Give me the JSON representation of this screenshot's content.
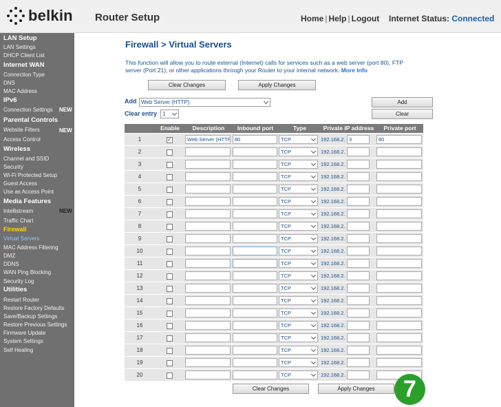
{
  "header": {
    "brand": "belkin",
    "app_title": "Router Setup",
    "nav": {
      "home": "Home",
      "help": "Help",
      "logout": "Logout"
    },
    "status_label": "Internet Status:",
    "status_value": "Connected"
  },
  "sidebar": {
    "sections": [
      {
        "title": "LAN Setup",
        "items": [
          "LAN Settings",
          "DHCP Client List"
        ]
      },
      {
        "title": "Internet WAN",
        "items": [
          "Connection Type",
          "DNS",
          "MAC Address"
        ]
      },
      {
        "title": "IPv6",
        "items": [
          "Connection Settings"
        ]
      },
      {
        "title": "Parental Controls",
        "items": [
          "Website Filters",
          "Access Control"
        ]
      },
      {
        "title": "Wireless",
        "items": [
          "Channel and SSID",
          "Security",
          "Wi-Fi Protected Setup",
          "Guest Access",
          "Use as Access Point"
        ]
      },
      {
        "title": "Media Features",
        "items": [
          "Intellistream",
          "Traffic Chart"
        ]
      },
      {
        "title": "Firewall",
        "items": [
          "Virtual Servers",
          "MAC Address Filtering",
          "DMZ",
          "DDNS",
          "WAN Ping Blocking",
          "Security Log"
        ]
      },
      {
        "title": "Utilities",
        "items": [
          "Restart Router",
          "Restore Factory Defaults",
          "Save/Backup Settings",
          "Restore Previous Settings",
          "Firmware Update",
          "System Settings",
          "Self Healing"
        ]
      }
    ],
    "new_badge": "NEW"
  },
  "main": {
    "title": "Firewall > Virtual Servers",
    "description": "This function will allow you to route external (Internet) calls for services such as a web server (port 80), FTP server (Port 21), or other applications through your Router to your internal network.",
    "more_info": "More Info",
    "clear_changes": "Clear Changes",
    "apply_changes": "Apply Changes",
    "add_label": "Add",
    "add_select": "Web Server (HTTP)",
    "add_button": "Add",
    "clear_entry_label": "Clear entry",
    "clear_entry_select": "1",
    "clear_button": "Clear"
  },
  "table": {
    "headers": [
      "Enable",
      "Description",
      "Inbound port",
      "Type",
      "Private IP address",
      "Private port"
    ],
    "ip_prefix": "192.168.2.",
    "rows": [
      {
        "num": "1",
        "enabled": true,
        "description": "Web Server (HTTP)",
        "inbound": "80",
        "type": "TCP",
        "ip_last": "3",
        "private_port": "80"
      },
      {
        "num": "2",
        "enabled": false,
        "description": "",
        "inbound": "",
        "type": "TCP",
        "ip_last": "",
        "private_port": ""
      },
      {
        "num": "3",
        "enabled": false,
        "description": "",
        "inbound": "",
        "type": "TCP",
        "ip_last": "",
        "private_port": ""
      },
      {
        "num": "4",
        "enabled": false,
        "description": "",
        "inbound": "",
        "type": "TCP",
        "ip_last": "",
        "private_port": ""
      },
      {
        "num": "5",
        "enabled": false,
        "description": "",
        "inbound": "",
        "type": "TCP",
        "ip_last": "",
        "private_port": ""
      },
      {
        "num": "6",
        "enabled": false,
        "description": "",
        "inbound": "",
        "type": "TCP",
        "ip_last": "",
        "private_port": ""
      },
      {
        "num": "7",
        "enabled": false,
        "description": "",
        "inbound": "",
        "type": "TCP",
        "ip_last": "",
        "private_port": ""
      },
      {
        "num": "8",
        "enabled": false,
        "description": "",
        "inbound": "",
        "type": "TCP",
        "ip_last": "",
        "private_port": ""
      },
      {
        "num": "9",
        "enabled": false,
        "description": "",
        "inbound": "",
        "type": "TCP",
        "ip_last": "",
        "private_port": ""
      },
      {
        "num": "10",
        "enabled": false,
        "description": "",
        "inbound": "",
        "type": "TCP",
        "ip_last": "",
        "private_port": ""
      },
      {
        "num": "11",
        "enabled": false,
        "description": "",
        "inbound": "",
        "type": "TCP",
        "ip_last": "",
        "private_port": ""
      },
      {
        "num": "12",
        "enabled": false,
        "description": "",
        "inbound": "",
        "type": "TCP",
        "ip_last": "",
        "private_port": ""
      },
      {
        "num": "13",
        "enabled": false,
        "description": "",
        "inbound": "",
        "type": "TCP",
        "ip_last": "",
        "private_port": ""
      },
      {
        "num": "14",
        "enabled": false,
        "description": "",
        "inbound": "",
        "type": "TCP",
        "ip_last": "",
        "private_port": ""
      },
      {
        "num": "15",
        "enabled": false,
        "description": "",
        "inbound": "",
        "type": "TCP",
        "ip_last": "",
        "private_port": ""
      },
      {
        "num": "16",
        "enabled": false,
        "description": "",
        "inbound": "",
        "type": "TCP",
        "ip_last": "",
        "private_port": ""
      },
      {
        "num": "17",
        "enabled": false,
        "description": "",
        "inbound": "",
        "type": "TCP",
        "ip_last": "",
        "private_port": ""
      },
      {
        "num": "18",
        "enabled": false,
        "description": "",
        "inbound": "",
        "type": "TCP",
        "ip_last": "",
        "private_port": ""
      },
      {
        "num": "19",
        "enabled": false,
        "description": "",
        "inbound": "",
        "type": "TCP",
        "ip_last": "",
        "private_port": ""
      },
      {
        "num": "20",
        "enabled": false,
        "description": "",
        "inbound": "",
        "type": "TCP",
        "ip_last": "",
        "private_port": ""
      }
    ]
  },
  "step_badge": "7",
  "colors": {
    "accent": "#1a4f8b",
    "link": "#2a6fc9",
    "connected": "#1a5fa8",
    "active_menu": "#ffd800",
    "badge": "#2aa02a"
  }
}
